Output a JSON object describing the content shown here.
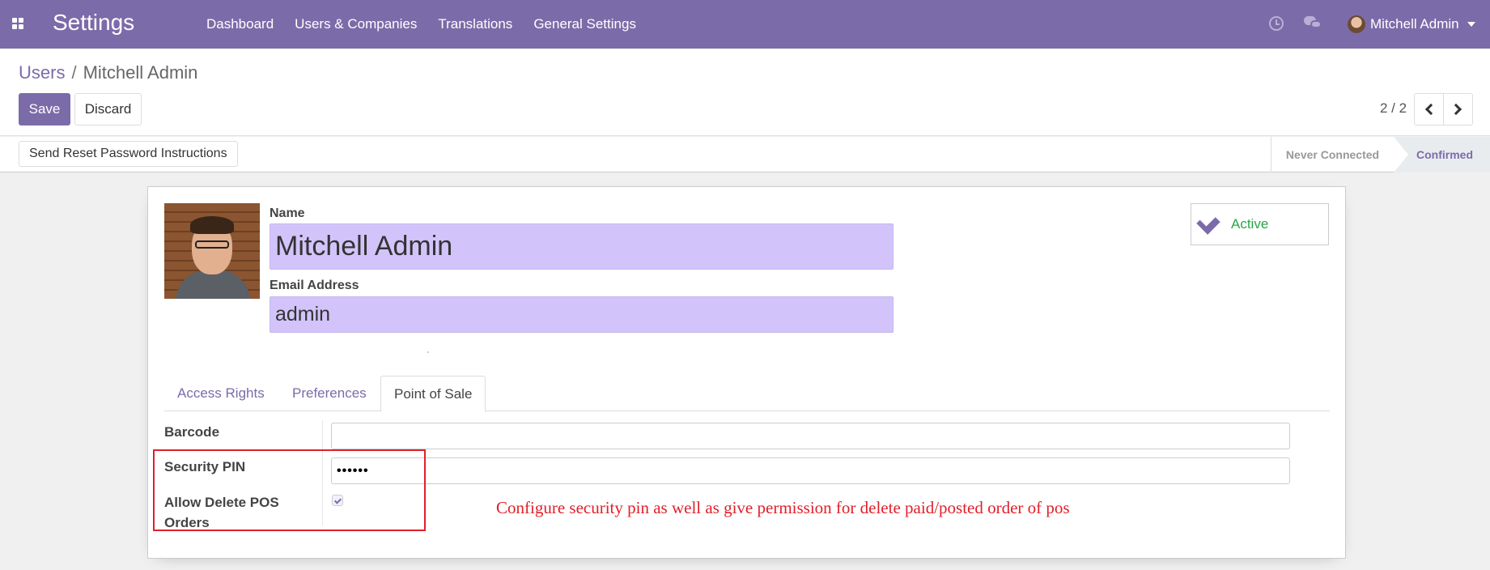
{
  "navbar": {
    "app_title": "Settings",
    "menu": [
      "Dashboard",
      "Users & Companies",
      "Translations",
      "General Settings"
    ],
    "user_name": "Mitchell Admin",
    "color": "#7c6ba9"
  },
  "breadcrumb": {
    "parent": "Users",
    "separator": "/",
    "current": "Mitchell Admin"
  },
  "buttons": {
    "save": "Save",
    "discard": "Discard",
    "reset_password": "Send Reset Password Instructions"
  },
  "pager": {
    "value": "2 / 2"
  },
  "status": {
    "stages": [
      "Never Connected",
      "Confirmed"
    ],
    "current": "Confirmed"
  },
  "form": {
    "name_label": "Name",
    "name_value": "Mitchell Admin",
    "email_label": "Email Address",
    "email_value": "admin",
    "active_label": "Active"
  },
  "tabs": [
    "Access Rights",
    "Preferences",
    "Point of Sale"
  ],
  "pos": {
    "barcode_label": "Barcode",
    "barcode_value": "",
    "pin_label": "Security PIN",
    "pin_value": "••••••",
    "delete_label": "Allow Delete POS Orders",
    "delete_checked": true
  },
  "annotation": {
    "text": "Configure security pin as well as give permission for delete paid/posted order of pos",
    "color": "#e0202a"
  }
}
